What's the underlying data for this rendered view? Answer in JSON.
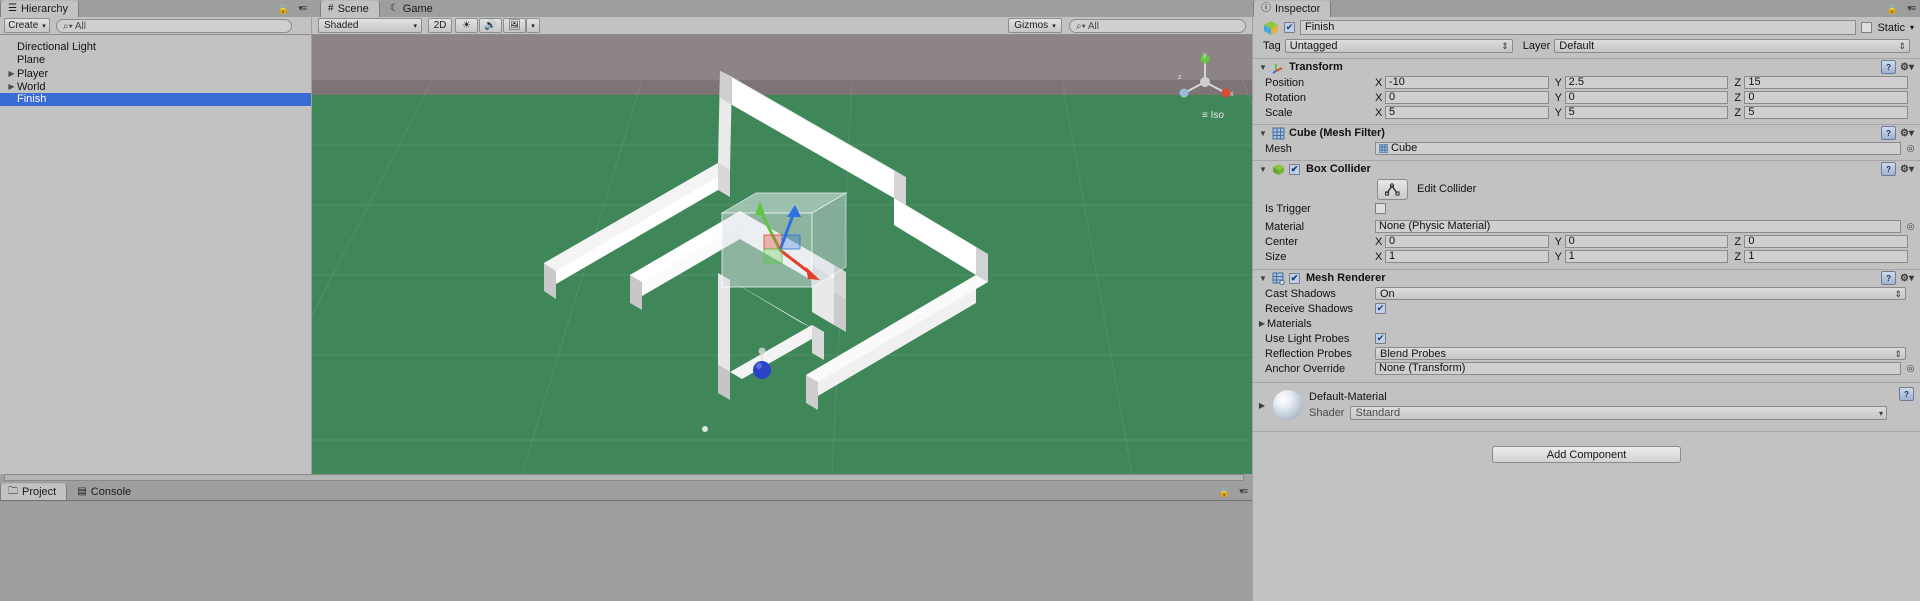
{
  "hierarchy": {
    "tab": {
      "label": "Hierarchy",
      "icon": "hierarchy-icon"
    },
    "toolbar": {
      "create_label": "Create",
      "create_caret": "▾",
      "search_placeholder": "All",
      "search_icon": "search-icon",
      "lock_icon": "lock-icon",
      "menu_icon": "panel-menu-icon"
    },
    "items": [
      {
        "label": "Directional Light",
        "expandable": false,
        "selected": false,
        "indent": 0
      },
      {
        "label": "Plane",
        "expandable": false,
        "selected": false,
        "indent": 0
      },
      {
        "label": "Player",
        "expandable": true,
        "selected": false,
        "indent": 0
      },
      {
        "label": "World",
        "expandable": true,
        "selected": false,
        "indent": 0
      },
      {
        "label": "Finish",
        "expandable": false,
        "selected": true,
        "indent": 0
      }
    ]
  },
  "scene": {
    "tabs": [
      {
        "label": "Scene",
        "icon": "scene-grid-icon",
        "active": true
      },
      {
        "label": "Game",
        "icon": "game-moon-icon",
        "active": false
      }
    ],
    "toolbar": {
      "draw_mode": "Shaded",
      "mode_2d": "2D",
      "lighting_icon": "sun-icon",
      "audio_icon": "speaker-icon",
      "fx_icon": "image-icon",
      "fx_caret": "▾",
      "gizmos_label": "Gizmos",
      "gizmos_caret": "▾",
      "search_placeholder": "All",
      "search_icon": "search-icon"
    },
    "viewport": {
      "projection_label": "Iso",
      "projection_icon": "iso-lines-icon",
      "axis_x": "x",
      "axis_y": "y",
      "axis_z": "z",
      "ground_color": "#3f8759",
      "sky_color": "#837a7a",
      "wall_color": "#e9e9e9",
      "handle_x_color": "#e2402a",
      "handle_y_color": "#5cc63f",
      "handle_z_color": "#2f6fe0"
    }
  },
  "inspector": {
    "tab": {
      "label": "Inspector",
      "icon": "info-icon"
    },
    "lock_icon": "lock-icon",
    "menu_icon": "panel-menu-icon",
    "object": {
      "enabled": true,
      "name": "Finish",
      "static_label": "Static",
      "static_checked": false,
      "static_caret": "▾",
      "tag_label": "Tag",
      "tag_value": "Untagged",
      "layer_label": "Layer",
      "layer_value": "Default"
    },
    "components": [
      {
        "title": "Transform",
        "icon": "transform-icon",
        "expanded": true,
        "has_checkbox": false,
        "rows": [
          {
            "type": "vector3",
            "label": "Position",
            "x": "-10",
            "y": "2.5",
            "z": "15"
          },
          {
            "type": "vector3",
            "label": "Rotation",
            "x": "0",
            "y": "0",
            "z": "0"
          },
          {
            "type": "vector3",
            "label": "Scale",
            "x": "5",
            "y": "5",
            "z": "5"
          }
        ]
      },
      {
        "title": "Cube (Mesh Filter)",
        "icon": "mesh-filter-icon",
        "expanded": true,
        "has_checkbox": false,
        "rows": [
          {
            "type": "object",
            "label": "Mesh",
            "value": "Cube",
            "value_icon": "mesh-icon"
          }
        ]
      },
      {
        "title": "Box Collider",
        "icon": "box-collider-icon",
        "expanded": true,
        "has_checkbox": true,
        "checked": true,
        "rows": [
          {
            "type": "editcollider",
            "label": "",
            "button_label": "Edit Collider",
            "button_icon": "collider-edit-icon"
          },
          {
            "type": "checkbox",
            "label": "Is Trigger",
            "checked": false
          },
          {
            "type": "object",
            "label": "Material",
            "value": "None (Physic Material)"
          },
          {
            "type": "vector3",
            "label": "Center",
            "x": "0",
            "y": "0",
            "z": "0"
          },
          {
            "type": "vector3",
            "label": "Size",
            "x": "1",
            "y": "1",
            "z": "1"
          }
        ]
      },
      {
        "title": "Mesh Renderer",
        "icon": "mesh-renderer-icon",
        "expanded": true,
        "has_checkbox": true,
        "checked": true,
        "rows": [
          {
            "type": "dropdown",
            "label": "Cast Shadows",
            "value": "On"
          },
          {
            "type": "checkbox",
            "label": "Receive Shadows",
            "checked": true
          },
          {
            "type": "foldout",
            "label": "Materials"
          },
          {
            "type": "checkbox",
            "label": "Use Light Probes",
            "checked": true
          },
          {
            "type": "dropdown",
            "label": "Reflection Probes",
            "value": "Blend Probes"
          },
          {
            "type": "object",
            "label": "Anchor Override",
            "value": "None (Transform)"
          }
        ]
      }
    ],
    "material": {
      "name": "Default-Material",
      "shader_label": "Shader",
      "shader_value": "Standard",
      "preview_icon": "material-sphere-icon",
      "foldout": "▶"
    },
    "add_component_label": "Add Component"
  },
  "bottom": {
    "tabs": [
      {
        "label": "Project",
        "icon": "folder-icon",
        "active": true
      },
      {
        "label": "Console",
        "icon": "console-icon",
        "active": false
      }
    ],
    "lock_icon": "lock-icon",
    "menu_icon": "panel-menu-icon"
  }
}
